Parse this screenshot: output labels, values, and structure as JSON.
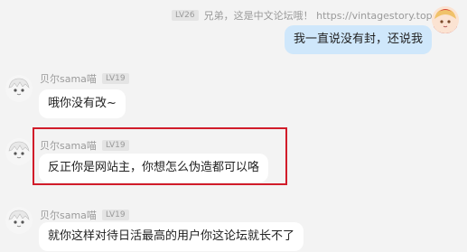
{
  "chat": {
    "self": {
      "level": "LV26",
      "name_line": "兄弟，这是中文论坛哦！ https://vintagestory.top/",
      "message": "我一直说没有封，还说我"
    },
    "messages": [
      {
        "username": "贝尔sama喵",
        "level": "LV19",
        "text": "哦你没有改~"
      },
      {
        "username": "贝尔sama喵",
        "level": "LV19",
        "text": "反正你是网站主，你想怎么伪造都可以咯"
      },
      {
        "username": "贝尔sama喵",
        "level": "LV19",
        "text": "就你这样对待日活最高的用户你这论坛就长不了"
      }
    ]
  },
  "colors": {
    "background": "#f3f3f3",
    "own_bubble": "#cfe7fb",
    "other_bubble": "#ffffff",
    "highlight_box": "#d11c2a"
  }
}
